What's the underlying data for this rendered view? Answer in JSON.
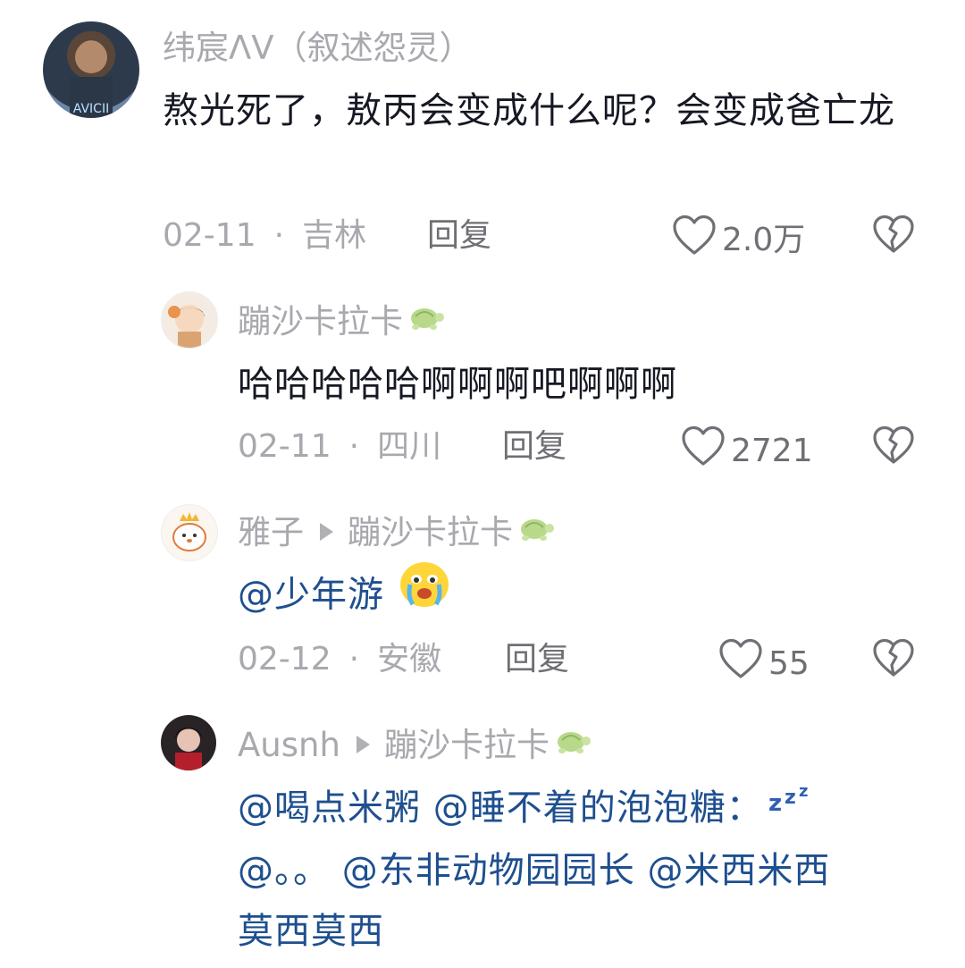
{
  "comments": [
    {
      "username": "纬宸ᐱᐯ（叙述怨灵）",
      "text": "熬光死了，敖丙会变成什么呢？会变成爸亡龙",
      "date": "02-11",
      "location": "吉林",
      "reply_label": "回复",
      "likes": "2.0万"
    },
    {
      "username": "蹦沙卡拉卡",
      "text": "哈哈哈哈哈啊啊啊吧啊啊啊",
      "date": "02-11",
      "location": "四川",
      "reply_label": "回复",
      "likes": "2721"
    },
    {
      "username": "雅子",
      "reply_to": "蹦沙卡拉卡",
      "mentions": [
        "@少年游"
      ],
      "date": "02-12",
      "location": "安徽",
      "reply_label": "回复",
      "likes": "55"
    },
    {
      "username": "Ausnh",
      "reply_to": "蹦沙卡拉卡",
      "mentions": [
        "@喝点米粥",
        "@睡不着的泡泡糖：",
        "@。。",
        "@东非动物园园长",
        "@米西米西",
        "莫西莫西"
      ]
    }
  ],
  "icons": {
    "like": "heart-outline-icon",
    "dislike": "broken-heart-icon",
    "badge": "turtle-icon",
    "emoji_crying": "crying-face-emoji",
    "emoji_sleep": "zzz-emoji"
  },
  "colors": {
    "username": "#a8a8ae",
    "text": "#161823",
    "mention": "#1e4f8f",
    "meta": "#a8a8ae"
  }
}
